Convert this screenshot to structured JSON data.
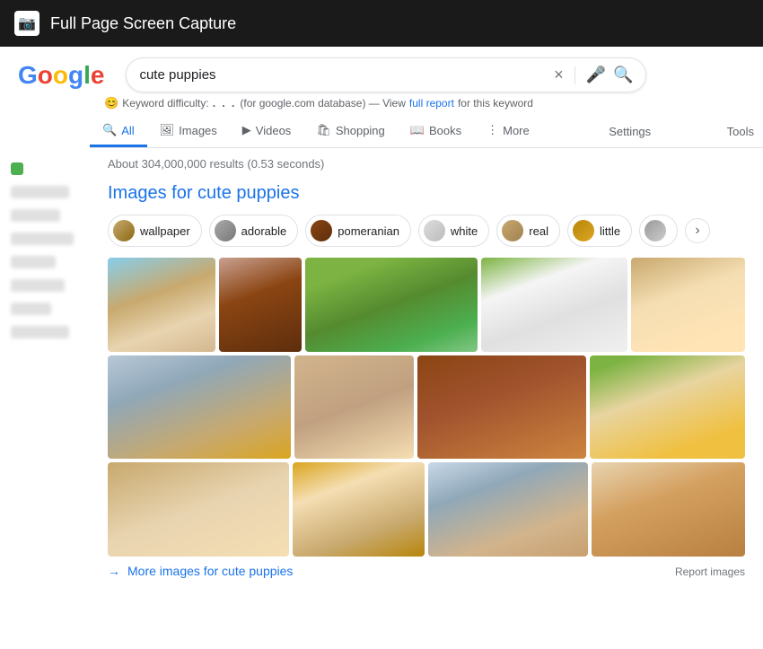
{
  "topbar": {
    "icon": "📷",
    "title": "Full Page Screen Capture"
  },
  "search": {
    "query": "cute puppies",
    "clear_label": "×",
    "mic_icon": "🎤",
    "search_icon": "🔍"
  },
  "keyword": {
    "icon": "😊",
    "text": "Keyword difficulty: ",
    "dots": ". . .",
    "db_text": " (for google.com database) — View ",
    "link_text": "full report",
    "suffix": " for this keyword"
  },
  "tabs": [
    {
      "label": "All",
      "icon": "🔍",
      "active": true
    },
    {
      "label": "Images",
      "icon": "🖼",
      "active": false
    },
    {
      "label": "Videos",
      "icon": "▶",
      "active": false
    },
    {
      "label": "Shopping",
      "icon": "🛍",
      "active": false
    },
    {
      "label": "Books",
      "icon": "📖",
      "active": false
    },
    {
      "label": "More",
      "icon": "⋮",
      "active": false
    }
  ],
  "settings_label": "Settings",
  "tools_label": "Tools",
  "results_count": "About 304,000,000 results (0.53 seconds)",
  "images_header": "Images for cute puppies",
  "pills": [
    {
      "label": "wallpaper"
    },
    {
      "label": "adorable"
    },
    {
      "label": "pomeranian"
    },
    {
      "label": "white"
    },
    {
      "label": "real"
    },
    {
      "label": "little"
    }
  ],
  "more_images": "More images for cute puppies",
  "report_images": "Report images",
  "images": [
    {
      "row": 1,
      "index": 1,
      "color": "puppy-1"
    },
    {
      "row": 1,
      "index": 2,
      "color": "puppy-2"
    },
    {
      "row": 1,
      "index": 3,
      "color": "puppy-3"
    },
    {
      "row": 1,
      "index": 4,
      "color": "puppy-4"
    },
    {
      "row": 1,
      "index": 5,
      "color": "puppy-5"
    },
    {
      "row": 2,
      "index": 6,
      "color": "puppy-6"
    },
    {
      "row": 2,
      "index": 7,
      "color": "puppy-7"
    },
    {
      "row": 2,
      "index": 8,
      "color": "puppy-8"
    },
    {
      "row": 2,
      "index": 9,
      "color": "puppy-9"
    },
    {
      "row": 3,
      "index": 10,
      "color": "puppy-10"
    },
    {
      "row": 3,
      "index": 11,
      "color": "puppy-11"
    },
    {
      "row": 3,
      "index": 12,
      "color": "puppy-12"
    },
    {
      "row": 3,
      "index": 13,
      "color": "puppy-13"
    }
  ]
}
